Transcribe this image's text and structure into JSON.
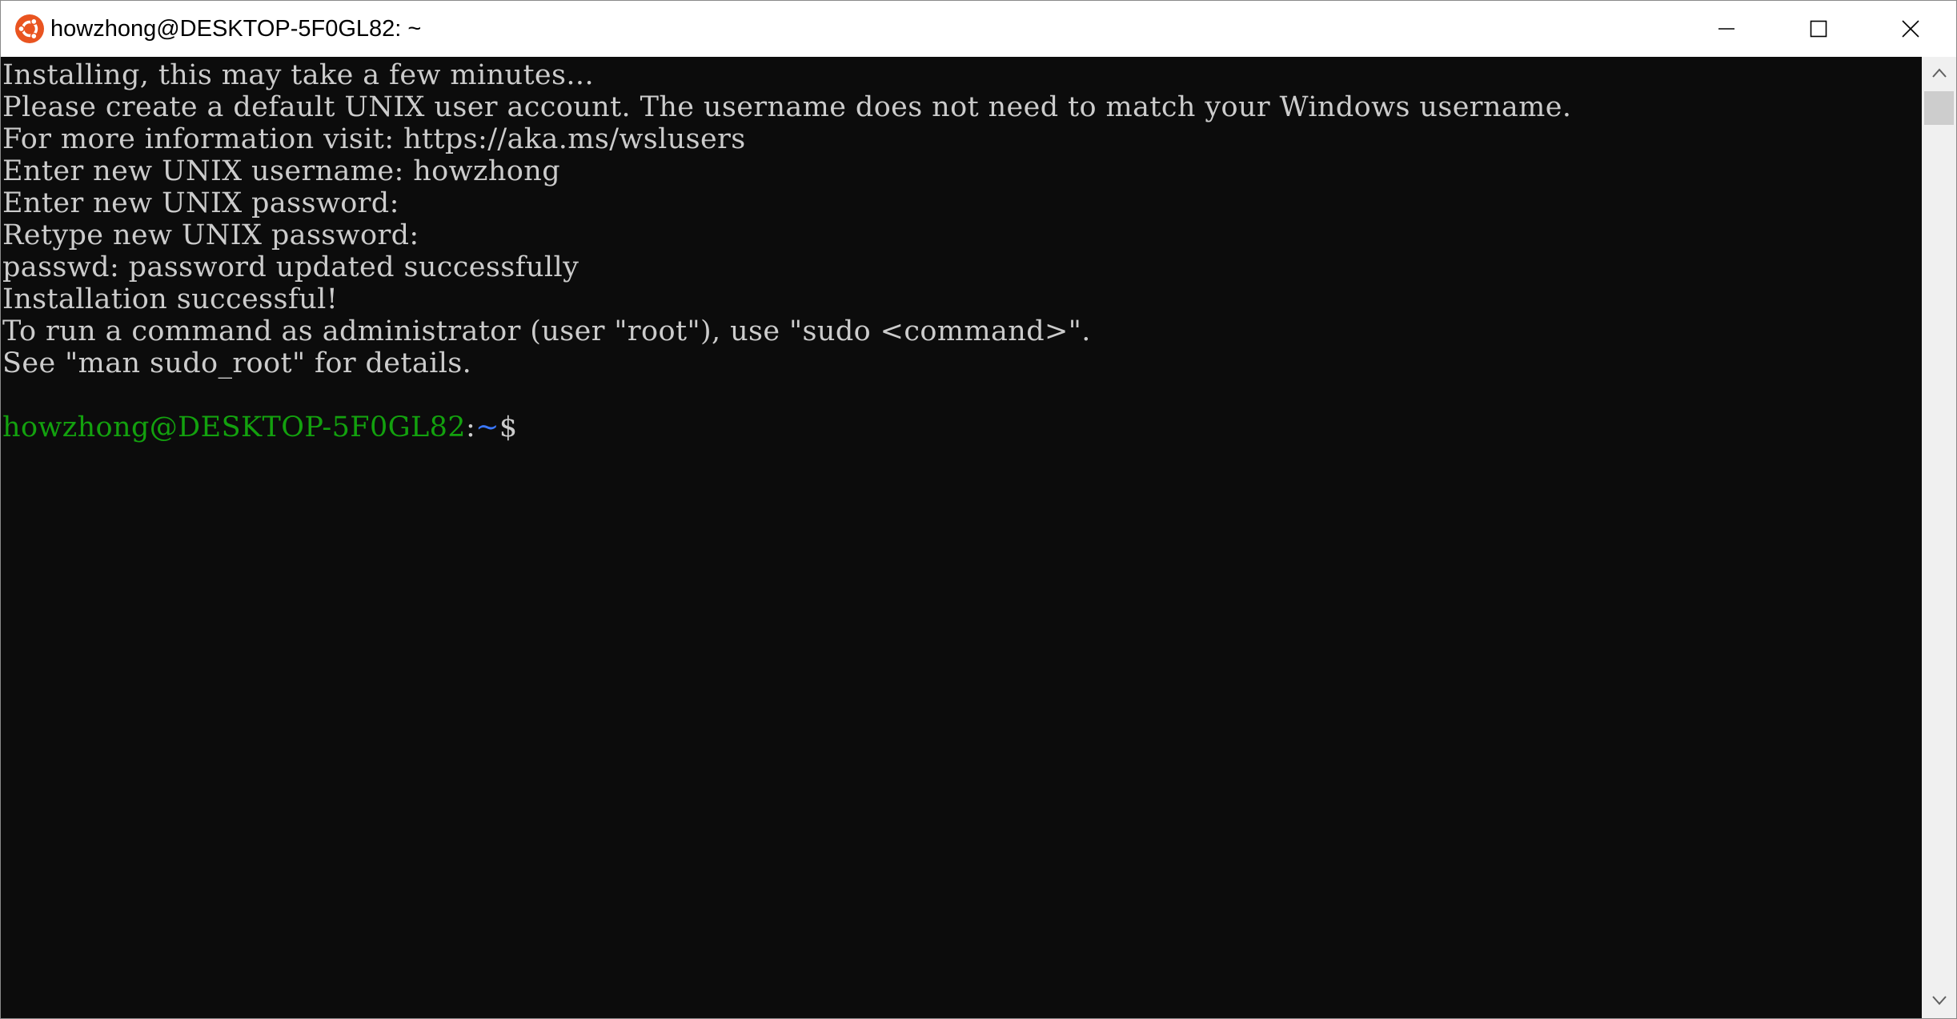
{
  "window": {
    "title": "howzhong@DESKTOP-5F0GL82: ~",
    "app_icon": "ubuntu-icon",
    "controls": {
      "minimize": "minimize-icon",
      "maximize": "maximize-icon",
      "close": "close-icon"
    }
  },
  "terminal": {
    "lines": [
      "Installing, this may take a few minutes...",
      "Please create a default UNIX user account. The username does not need to match your Windows username.",
      "For more information visit: https://aka.ms/wslusers",
      "Enter new UNIX username: howzhong",
      "Enter new UNIX password:",
      "Retype new UNIX password:",
      "passwd: password updated successfully",
      "Installation successful!",
      "To run a command as administrator (user \"root\"), use \"sudo <command>\".",
      "See \"man sudo_root\" for details."
    ],
    "prompt": {
      "user_host": "howzhong@DESKTOP-5F0GL82",
      "separator": ":",
      "path": "~",
      "symbol": "$"
    }
  },
  "colors": {
    "background": "#0c0c0c",
    "text": "#cccccc",
    "prompt_user": "#13a10e",
    "prompt_path": "#3b78ff",
    "ubuntu_orange": "#e95420"
  }
}
